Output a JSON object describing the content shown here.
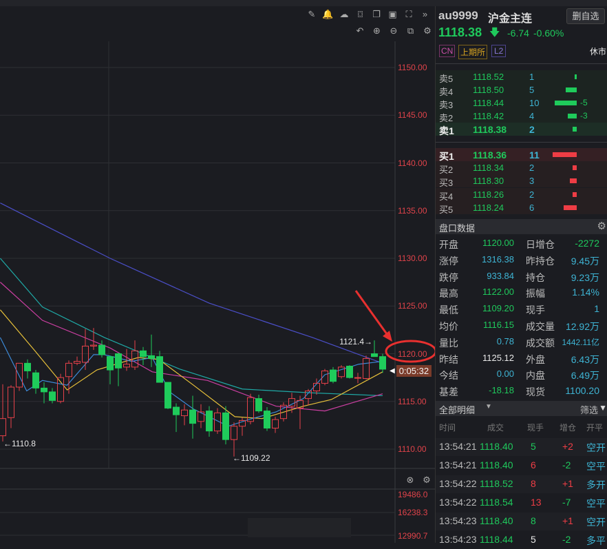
{
  "toolbar": {
    "row1": [
      "pencil-icon",
      "bell-icon",
      "cloud-icon",
      "camera-icon",
      "copy-icon",
      "monitor-chart-icon",
      "fullscreen-icon",
      "collapse-right-icon"
    ],
    "row1_glyphs": [
      "✎",
      "🔔",
      "☁",
      "⌼",
      "❐",
      "▣",
      "⛶",
      "»"
    ],
    "row2": [
      "undo-icon",
      "zoom-in-icon",
      "zoom-out-icon",
      "layout-icon",
      "settings-icon"
    ],
    "row2_glyphs": [
      "↶",
      "⊕",
      "⊖",
      "⧉",
      "⚙"
    ]
  },
  "chart_data": {
    "type": "candlestick",
    "price_axis": [
      "1150.00",
      "1145.00",
      "1140.00",
      "1135.00",
      "1130.00",
      "1125.00",
      "1120.00",
      "1115.00",
      "1110.00"
    ],
    "price_values": [
      1150,
      1145,
      1140,
      1135,
      1130,
      1125,
      1120,
      1115,
      1110
    ],
    "ylim": [
      1110,
      1150
    ],
    "colors": {
      "up": "#e8424a",
      "down": "#1fcb5b"
    },
    "candles": [
      [
        1111.4,
        1116.8,
        1110.8,
        1113.2
      ],
      [
        1113.3,
        1116.7,
        1112.2,
        1116.5
      ],
      [
        1116.5,
        1119.0,
        1116.1,
        1119.0
      ],
      [
        1119.0,
        1119.4,
        1117.4,
        1118.2
      ],
      [
        1118.0,
        1118.3,
        1115.8,
        1116.4
      ],
      [
        1116.4,
        1117.0,
        1114.8,
        1116.0
      ],
      [
        1116.0,
        1116.4,
        1114.8,
        1115.1
      ],
      [
        1115.0,
        1117.9,
        1114.8,
        1117.5
      ],
      [
        1117.6,
        1119.3,
        1115.8,
        1119.0
      ],
      [
        1119.0,
        1119.7,
        1118.8,
        1119.2
      ],
      [
        1119.1,
        1122.6,
        1118.3,
        1120.8
      ],
      [
        1120.8,
        1122.7,
        1120.4,
        1120.9
      ],
      [
        1120.9,
        1121.4,
        1119.6,
        1119.9
      ],
      [
        1119.7,
        1119.8,
        1116.8,
        1118.3
      ],
      [
        1120.0,
        1120.1,
        1116.6,
        1118.5
      ],
      [
        1118.6,
        1120.5,
        1118.2,
        1118.9
      ],
      [
        1118.6,
        1121.4,
        1118.3,
        1120.3
      ],
      [
        1120.3,
        1120.7,
        1118.8,
        1119.7
      ],
      [
        1119.8,
        1122.0,
        1118.6,
        1119.5
      ],
      [
        1119.7,
        1120.3,
        1117.0,
        1117.0
      ],
      [
        1117.0,
        1117.0,
        1114.2,
        1114.3
      ],
      [
        1114.4,
        1114.8,
        1111.8,
        1113.6
      ],
      [
        1113.5,
        1114.7,
        1112.5,
        1114.1
      ],
      [
        1114.1,
        1115.6,
        1111.1,
        1112.7
      ],
      [
        1112.9,
        1114.7,
        1112.2,
        1113.9
      ],
      [
        1114.0,
        1114.5,
        1111.3,
        1111.9
      ],
      [
        1111.9,
        1114.3,
        1111.6,
        1113.8
      ],
      [
        1113.8,
        1114.5,
        1110.5,
        1111.0
      ],
      [
        1111.0,
        1112.8,
        1109.22,
        1112.4
      ],
      [
        1112.4,
        1113.3,
        1111.4,
        1113.0
      ],
      [
        1112.9,
        1115.8,
        1112.6,
        1115.4
      ],
      [
        1115.3,
        1115.7,
        1113.8,
        1114.0
      ],
      [
        1114.0,
        1114.4,
        1111.9,
        1112.2
      ],
      [
        1112.2,
        1113.4,
        1111.7,
        1113.1
      ],
      [
        1113.2,
        1114.9,
        1112.9,
        1114.6
      ],
      [
        1114.5,
        1115.9,
        1113.8,
        1115.3
      ],
      [
        1114.3,
        1115.6,
        1112.1,
        1115.1
      ],
      [
        1115.3,
        1116.3,
        1114.6,
        1116.1
      ],
      [
        1116.1,
        1117.4,
        1115.7,
        1116.9
      ],
      [
        1116.9,
        1118.4,
        1116.7,
        1118.2
      ],
      [
        1118.3,
        1118.6,
        1116.9,
        1117.1
      ],
      [
        1117.6,
        1118.8,
        1117.4,
        1118.6
      ],
      [
        1118.7,
        1118.8,
        1117.4,
        1117.5
      ],
      [
        1117.5,
        1118.0,
        1116.9,
        1117.5
      ],
      [
        1117.4,
        1119.8,
        1117.3,
        1119.5
      ],
      [
        1120.0,
        1121.4,
        1119.7,
        1119.7
      ],
      [
        1119.7,
        1120.0,
        1118.0,
        1118.38
      ]
    ],
    "ma_lines": [
      {
        "color": "#4b4fc9",
        "points": [
          [
            -0.3,
            1135.8
          ],
          [
            13,
            1130.0
          ],
          [
            25,
            1125.3
          ],
          [
            37.5,
            1121.7
          ],
          [
            46,
            1119.0
          ]
        ]
      },
      {
        "color": "#1fa9a6",
        "points": [
          [
            -0.3,
            1130.0
          ],
          [
            4.8,
            1124.9
          ],
          [
            12.3,
            1121.7
          ],
          [
            21.4,
            1118.4
          ],
          [
            29,
            1116.3
          ],
          [
            37.3,
            1115.9
          ],
          [
            46,
            1115.6
          ]
        ]
      },
      {
        "color": "#cc3fa2",
        "points": [
          [
            -0.3,
            1127.5
          ],
          [
            4.8,
            1123.5
          ],
          [
            13,
            1120.6
          ],
          [
            18.1,
            1118.1
          ],
          [
            24.8,
            1117.2
          ],
          [
            33.1,
            1114.5
          ],
          [
            39,
            1114.0
          ],
          [
            46,
            1115.8
          ]
        ]
      },
      {
        "color": "#e8c13a",
        "points": [
          [
            -0.3,
            1124.6
          ],
          [
            3.9,
            1120.3
          ],
          [
            7.8,
            1116.2
          ],
          [
            11.4,
            1118.3
          ],
          [
            16.4,
            1119.6
          ],
          [
            18.9,
            1119.4
          ],
          [
            23.1,
            1116.7
          ],
          [
            28.1,
            1113.4
          ],
          [
            31.4,
            1113.2
          ],
          [
            36.4,
            1114.5
          ],
          [
            39.8,
            1115.2
          ],
          [
            46,
            1118.1
          ]
        ]
      },
      {
        "color": "#3d8ad8",
        "points": [
          [
            -0.3,
            1121.7
          ],
          [
            2.9,
            1116.1
          ],
          [
            4.8,
            1117.2
          ],
          [
            7.8,
            1116.7
          ],
          [
            11,
            1119.9
          ],
          [
            12.3,
            1119.9
          ],
          [
            15.6,
            1119.2
          ],
          [
            18.1,
            1119.6
          ],
          [
            20.2,
            1116.0
          ],
          [
            23.1,
            1114.2
          ],
          [
            27.3,
            1112.4
          ],
          [
            29.8,
            1113.1
          ],
          [
            33.1,
            1113.9
          ],
          [
            36.4,
            1115.3
          ],
          [
            39,
            1117.8
          ],
          [
            43.1,
            1118.9
          ],
          [
            46,
            1119.2
          ]
        ]
      }
    ],
    "annotations": {
      "low_left": "←1110.8",
      "low": "←1109.22",
      "high": "1121.4→"
    },
    "countdown": "0:05:32"
  },
  "subpane": {
    "axis": [
      "19486.0",
      "16238.3",
      "12990.7"
    ],
    "icons": [
      "close-circle-icon",
      "settings-icon"
    ],
    "glyphs": [
      "⊗",
      "⚙"
    ]
  },
  "header": {
    "code": "au9999",
    "name": "沪金主连",
    "remove_btn": "删自选",
    "price": "1118.38",
    "arrow": "🡇",
    "change": "-6.74",
    "pct": "-0.60%",
    "tags": [
      "CN",
      "上期所",
      "L2"
    ],
    "status": "休市"
  },
  "orderbook": {
    "sell": [
      {
        "label": "卖5",
        "price": "1118.52",
        "vol": "1",
        "chg": "",
        "w": 1
      },
      {
        "label": "卖4",
        "price": "1118.50",
        "vol": "5",
        "chg": "",
        "w": 5
      },
      {
        "label": "卖3",
        "price": "1118.44",
        "vol": "10",
        "chg": "-5",
        "w": 10
      },
      {
        "label": "卖2",
        "price": "1118.42",
        "vol": "4",
        "chg": "-3",
        "w": 4
      },
      {
        "label": "卖1",
        "price": "1118.38",
        "vol": "2",
        "chg": "",
        "w": 2
      }
    ],
    "buy": [
      {
        "label": "买1",
        "price": "1118.36",
        "vol": "11",
        "w": 11
      },
      {
        "label": "买2",
        "price": "1118.34",
        "vol": "2",
        "w": 2
      },
      {
        "label": "买3",
        "price": "1118.30",
        "vol": "3",
        "w": 3
      },
      {
        "label": "买4",
        "price": "1118.26",
        "vol": "2",
        "w": 2
      },
      {
        "label": "买5",
        "price": "1118.24",
        "vol": "6",
        "w": 6
      }
    ]
  },
  "stats": {
    "title": "盘口数据",
    "rows": [
      {
        "l1": "开盘",
        "v1": "1120.00",
        "c1": "green",
        "l2": "日增仓",
        "v2": "-2272",
        "c2": "green"
      },
      {
        "l1": "涨停",
        "v1": "1316.38",
        "c1": "cyan",
        "l2": "昨持仓",
        "v2": "9.45万",
        "c2": "cyan"
      },
      {
        "l1": "跌停",
        "v1": "933.84",
        "c1": "cyan",
        "l2": "持仓",
        "v2": "9.23万",
        "c2": "cyan"
      },
      {
        "l1": "最高",
        "v1": "1122.00",
        "c1": "green",
        "l2": "振幅",
        "v2": "1.14%",
        "c2": "cyan"
      },
      {
        "l1": "最低",
        "v1": "1109.20",
        "c1": "green",
        "l2": "现手",
        "v2": "1",
        "c2": "cyan"
      },
      {
        "l1": "均价",
        "v1": "1116.15",
        "c1": "green",
        "l2": "成交量",
        "v2": "12.92万",
        "c2": "cyan"
      },
      {
        "l1": "量比",
        "v1": "0.78",
        "c1": "cyan",
        "l2": "成交额",
        "v2": "1442.11亿",
        "c2": "cyan"
      },
      {
        "l1": "昨结",
        "v1": "1125.12",
        "c1": "white",
        "l2": "外盘",
        "v2": "6.43万",
        "c2": "cyan"
      },
      {
        "l1": "今结",
        "v1": "0.00",
        "c1": "cyan",
        "l2": "内盘",
        "v2": "6.49万",
        "c2": "cyan"
      },
      {
        "l1": "基差",
        "v1": "-18.18",
        "c1": "green",
        "l2": "现货",
        "v2": "1100.20",
        "c2": "cyan"
      }
    ]
  },
  "trades": {
    "title": "全部明细",
    "filter": "筛选",
    "headers": [
      "时间",
      "成交",
      "现手",
      "增仓",
      "开平"
    ],
    "rows": [
      {
        "time": "13:54:21",
        "price": "1118.40",
        "vol": "5",
        "vc": "green",
        "oi": "+2",
        "oc": "red",
        "type": "空开"
      },
      {
        "time": "13:54:21",
        "price": "1118.40",
        "vol": "6",
        "vc": "red",
        "oi": "-2",
        "oc": "green",
        "type": "空平"
      },
      {
        "time": "13:54:22",
        "price": "1118.52",
        "vol": "8",
        "vc": "red",
        "oi": "+1",
        "oc": "red",
        "type": "多开"
      },
      {
        "time": "13:54:22",
        "price": "1118.54",
        "vol": "13",
        "vc": "red",
        "oi": "-7",
        "oc": "green",
        "type": "空平"
      },
      {
        "time": "13:54:23",
        "price": "1118.40",
        "vol": "8",
        "vc": "green",
        "oi": "+1",
        "oc": "red",
        "type": "空开"
      },
      {
        "time": "13:54:23",
        "price": "1118.44",
        "vol": "5",
        "vc": "white",
        "oi": "-2",
        "oc": "green",
        "type": "多平"
      }
    ]
  }
}
